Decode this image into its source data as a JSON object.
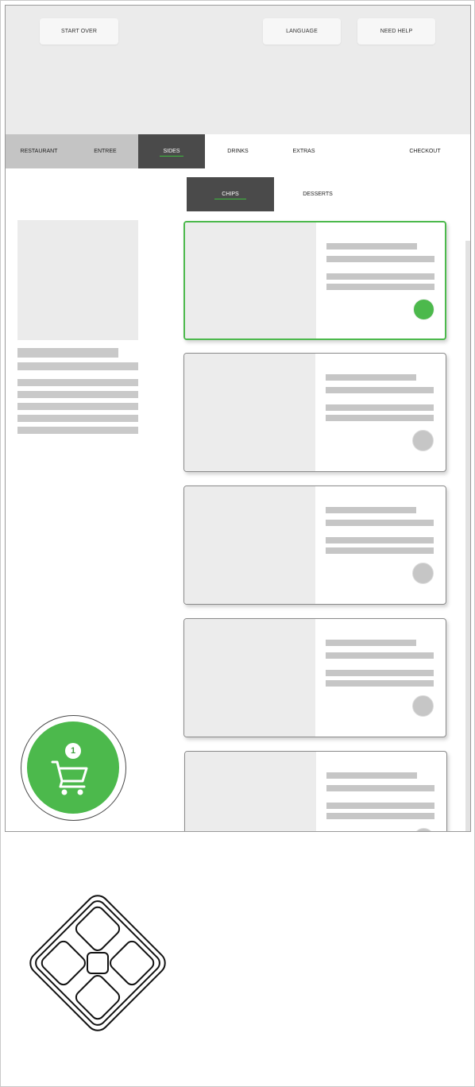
{
  "header": {
    "start_over": "START OVER",
    "language": "LANGUAGE",
    "need_help": "NEED HELP"
  },
  "nav": {
    "tabs": [
      "RESTAURANT",
      "ENTREE",
      "SIDES",
      "DRINKS",
      "EXTRAS",
      "CHECKOUT"
    ],
    "active": "SIDES"
  },
  "subnav": {
    "tabs": [
      "CHIPS",
      "DESSERTS"
    ],
    "active": "CHIPS"
  },
  "products": {
    "count_visible": 5,
    "selected_index": 0
  },
  "cart": {
    "count": "1",
    "icon": "shopping-cart-icon"
  },
  "controls": {
    "dpad_icon": "directional-pad-icon"
  },
  "colors": {
    "accent": "#4cb94c",
    "active_tab": "#4a4a4a",
    "placeholder": "#c6c6c6"
  }
}
